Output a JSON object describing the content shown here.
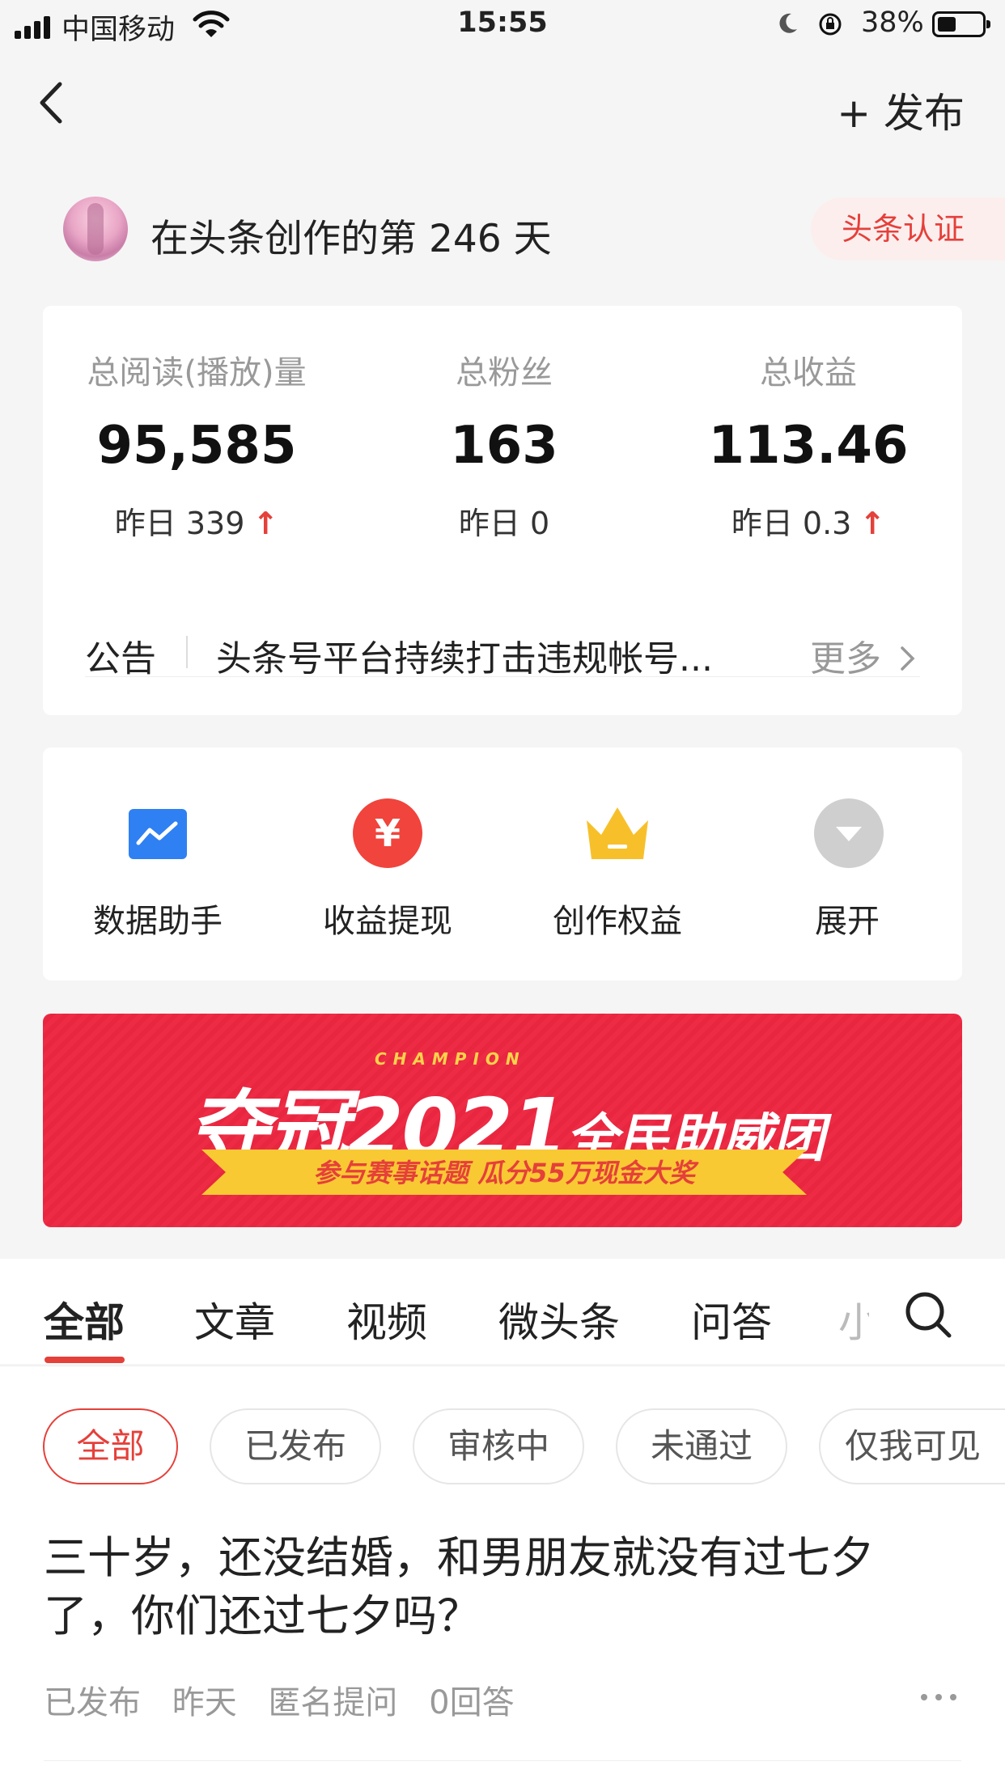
{
  "status_bar": {
    "carrier": "中国移动",
    "time": "15:55",
    "battery": "38%",
    "battery_level": 0.38
  },
  "nav": {
    "publish_label": "+ 发布"
  },
  "profile": {
    "days_text": "在头条创作的第 246 天",
    "cert_label": "头条认证"
  },
  "stats": [
    {
      "label": "总阅读(播放)量",
      "value": "95,585",
      "sub": "昨日 339",
      "trend": "↑"
    },
    {
      "label": "总粉丝",
      "value": "163",
      "sub": "昨日 0",
      "trend": ""
    },
    {
      "label": "总收益",
      "value": "113.46",
      "sub": "昨日 0.3",
      "trend": "↑"
    }
  ],
  "notice": {
    "label": "公告",
    "text": "头条号平台持续打击违规帐号...",
    "more": "更多"
  },
  "tools": [
    {
      "label": "数据助手",
      "icon": "data-chart-icon",
      "color": "#2f80f2"
    },
    {
      "label": "收益提现",
      "icon": "yuan-icon",
      "color": "#f0443d",
      "glyph": "¥"
    },
    {
      "label": "创作权益",
      "icon": "crown-icon",
      "color": "#f7c02b"
    },
    {
      "label": "展开",
      "icon": "expand-icon",
      "color": "#cfcfcf"
    }
  ],
  "banner": {
    "champion": "CHAMPION",
    "main": "夺冠2021",
    "main_suffix": "全民助威团",
    "ribbon": "参与赛事话题  瓜分55万现金大奖",
    "bg_color": "#ee2b45"
  },
  "tabs": [
    "全部",
    "文章",
    "视频",
    "微头条",
    "问答",
    "小"
  ],
  "filters": [
    "全部",
    "已发布",
    "审核中",
    "未通过",
    "仅我可见"
  ],
  "post": {
    "title": "三十岁，还没结婚，和男朋友就没有过七夕了，你们还过七夕吗？",
    "meta": [
      "已发布",
      "昨天",
      "匿名提问",
      "0回答"
    ]
  },
  "accent_color": "#e5403a"
}
